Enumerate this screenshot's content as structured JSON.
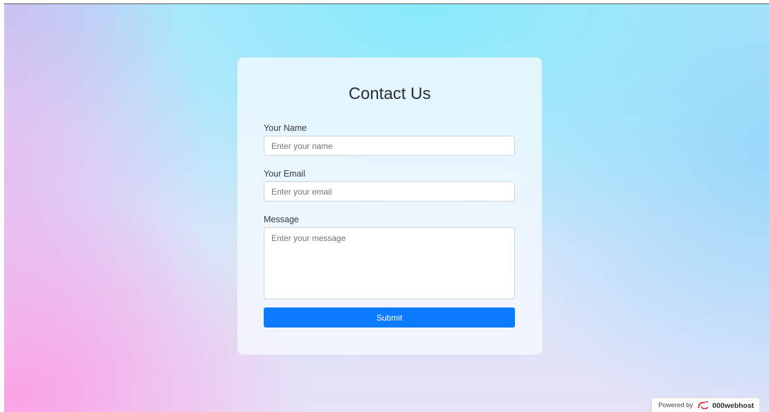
{
  "form": {
    "title": "Contact Us",
    "name_label": "Your Name",
    "name_value": "",
    "name_placeholder": "Enter your name",
    "email_label": "Your Email",
    "email_value": "",
    "email_placeholder": "Enter your email",
    "message_label": "Message",
    "message_value": "",
    "message_placeholder": "Enter your message",
    "submit_label": "Submit"
  },
  "footer": {
    "powered_by": "Powered by",
    "host_name": "000webhost",
    "logo_icon": "000webhost-logo-icon"
  },
  "colors": {
    "primary_button": "#0d7bfd",
    "logo_red": "#e0283c"
  }
}
